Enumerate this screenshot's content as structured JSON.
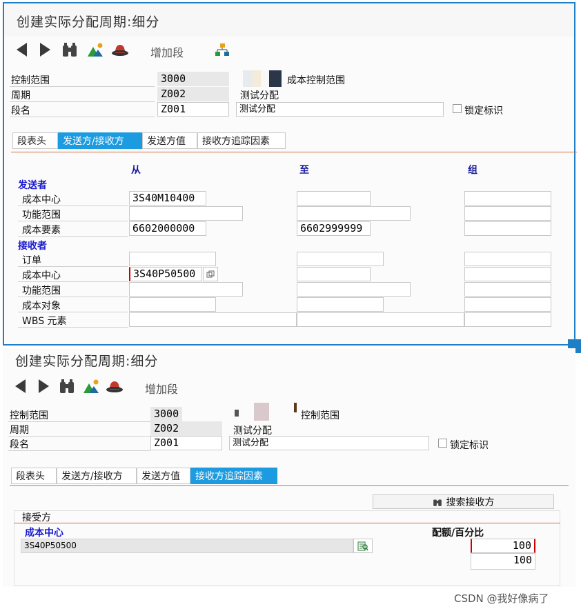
{
  "panel1": {
    "title": "创建实际分配周期:细分",
    "toolbar": {
      "add_segment": "增加段"
    },
    "header": {
      "controlling_area_label": "控制范围",
      "controlling_area_value": "3000",
      "controlling_area_desc_suffix": "成本控制范围",
      "cycle_label": "周期",
      "cycle_value": "Z002",
      "cycle_desc": "测试分配",
      "segment_label": "段名",
      "segment_value": "Z001",
      "segment_desc": "测试分配",
      "lock_label": "锁定标识"
    },
    "tabs": [
      "段表头",
      "发送方/接收方",
      "发送方值",
      "接收方追踪因素"
    ],
    "active_tab": 1,
    "columns": {
      "from": "从",
      "to": "至",
      "group": "组"
    },
    "sender_section": "发送者",
    "sender_rows": [
      {
        "label": "成本中心",
        "from": "3S40M10400",
        "to": "",
        "group": ""
      },
      {
        "label": "功能范围",
        "from": "",
        "to": "",
        "group": ""
      },
      {
        "label": "成本要素",
        "from": "6602000000",
        "to": "6602999999",
        "group": ""
      }
    ],
    "receiver_section": "接收者",
    "receiver_rows": [
      {
        "label": "订单",
        "from": "",
        "to": "",
        "group": ""
      },
      {
        "label": "成本中心",
        "from": "3S40P50500",
        "to": "",
        "group": ""
      },
      {
        "label": "功能范围",
        "from": "",
        "to": "",
        "group": ""
      },
      {
        "label": "成本对象",
        "from": "",
        "to": "",
        "group": ""
      },
      {
        "label": "WBS 元素",
        "from": "",
        "to": "",
        "group": ""
      }
    ]
  },
  "panel2": {
    "title": "创建实际分配周期:细分",
    "toolbar": {
      "add_segment": "增加段"
    },
    "header": {
      "controlling_area_label": "控制范围",
      "controlling_area_value": "3000",
      "controlling_area_desc_suffix": "控制范围",
      "cycle_label": "周期",
      "cycle_value": "Z002",
      "cycle_desc": "测试分配",
      "segment_label": "段名",
      "segment_value": "Z001",
      "segment_desc": "测试分配",
      "lock_label": "锁定标识"
    },
    "tabs": [
      "段表头",
      "发送方/接收方",
      "发送方值",
      "接收方追踪因素"
    ],
    "active_tab": 3,
    "search_button": "搜索接收方",
    "receiver_label": "接受方",
    "cost_center_label": "成本中心",
    "quota_label": "配额/百分比",
    "cost_center_value": "3S40P50500",
    "quota_values": [
      "100",
      "100"
    ]
  },
  "watermark": "CSDN @我好像病了",
  "colors": {
    "frame_blue": "#1f7fc6",
    "tab_active": "#1c9be0",
    "section_blue": "#1a1ad0",
    "orange_rule": "#d46b3e"
  }
}
